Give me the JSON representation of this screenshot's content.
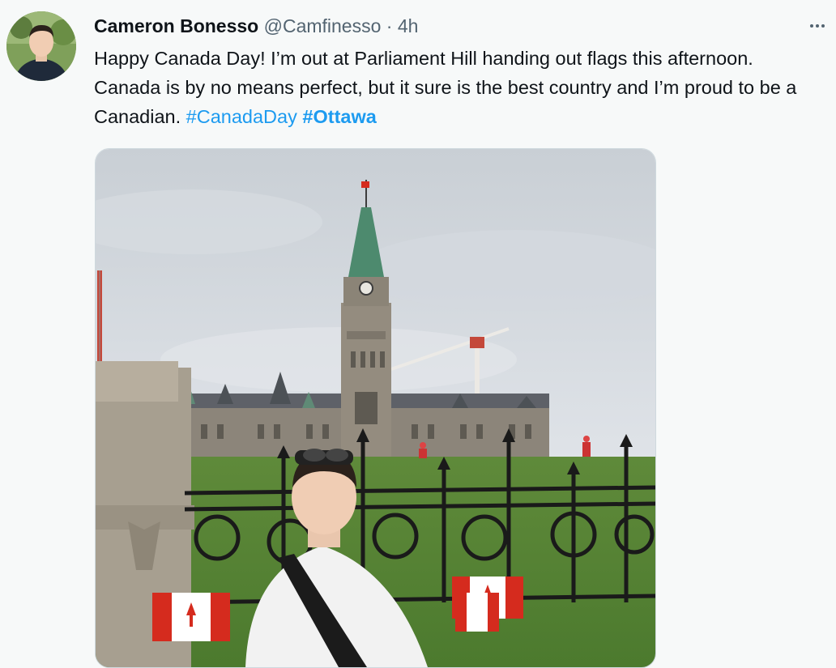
{
  "tweet": {
    "display_name": "Cameron Bonesso",
    "handle": "@Camfinesso",
    "separator": "·",
    "time": "4h",
    "text_part1": "Happy Canada Day! I’m out at Parliament Hill handing out flags this afternoon. Canada is by no means perfect, but it sure is the best country and I’m proud to be a Canadian. ",
    "hashtag1": "#CanadaDay",
    "hashtag2": "#Ottawa",
    "more_icon": "more-horizontal-icon"
  },
  "colors": {
    "link": "#1d9bf0",
    "text": "#0f1419",
    "secondary": "#536471",
    "background": "#f7f9f9"
  }
}
